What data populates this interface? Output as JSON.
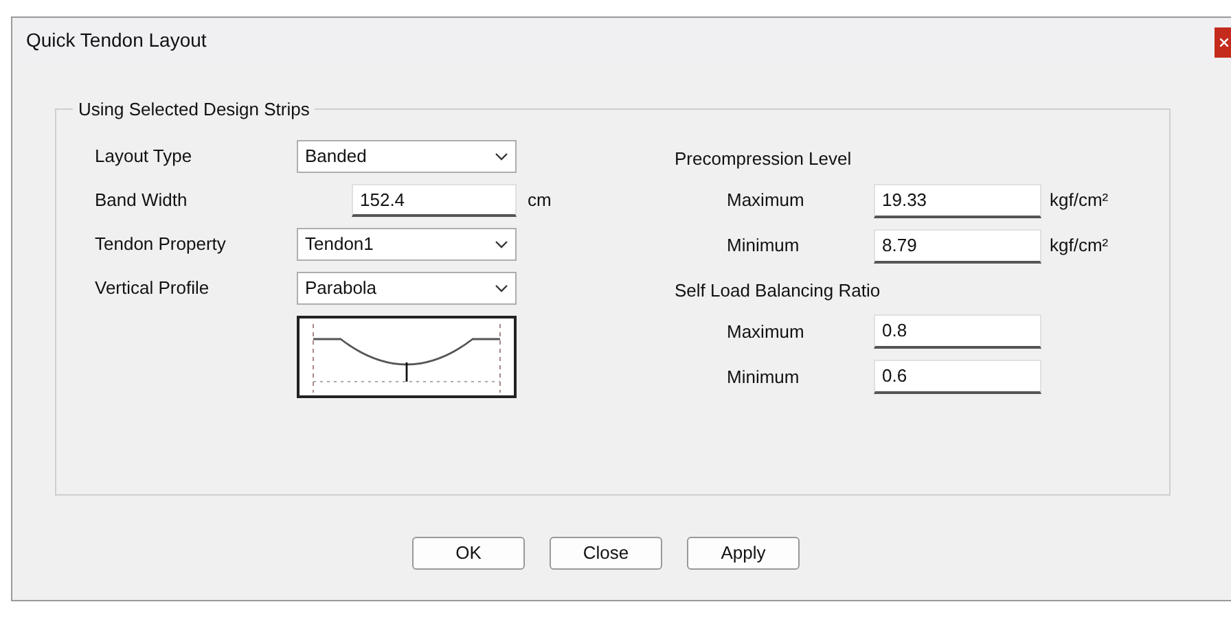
{
  "window": {
    "title": "Quick Tendon Layout"
  },
  "group": {
    "title": "Using Selected Design Strips"
  },
  "left_fields": [
    {
      "kind": "dropdown",
      "label": "Layout Type",
      "value": "Banded"
    },
    {
      "kind": "input",
      "label": "Band Width",
      "value": "152.4",
      "unit": "cm"
    },
    {
      "kind": "dropdown",
      "label": "Tendon Property",
      "value": "Tendon1"
    },
    {
      "kind": "dropdown",
      "label": "Vertical Profile",
      "value": "Parabola"
    }
  ],
  "sections": [
    {
      "title": "Precompression Level",
      "fields": [
        {
          "label": "Maximum",
          "value": "19.33",
          "unit": "kgf/cm²"
        },
        {
          "label": "Minimum",
          "value": "8.79",
          "unit": "kgf/cm²"
        }
      ]
    },
    {
      "title": "Self Load Balancing Ratio",
      "fields": [
        {
          "label": "Maximum",
          "value": "0.8"
        },
        {
          "label": "Minimum",
          "value": "0.6"
        }
      ]
    }
  ],
  "buttons": [
    "OK",
    "Close",
    "Apply"
  ]
}
